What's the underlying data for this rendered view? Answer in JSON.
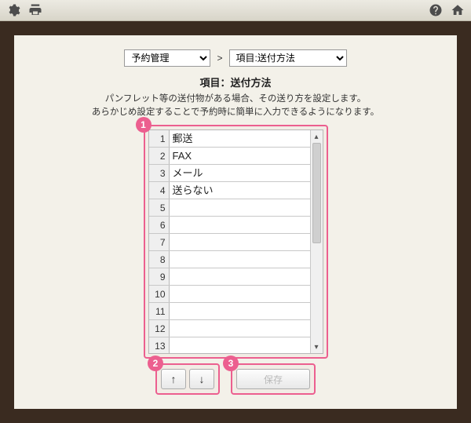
{
  "toolbar": {
    "icons": {
      "settings": "gear-icon",
      "print": "print-icon",
      "help": "help-icon",
      "home": "home-icon"
    }
  },
  "breadcrumb": {
    "left_selected": "予約管理",
    "separator": ">",
    "right_selected": "項目:送付方法"
  },
  "heading": "項目：送付方法",
  "description_line1": "パンフレット等の送付物がある場合、その送り方を設定します。",
  "description_line2": "あらかじめ設定することで予約時に簡単に入力できるようになります。",
  "annotations": {
    "grid": "1",
    "arrows": "2",
    "save": "3"
  },
  "grid": {
    "rows": [
      {
        "n": "1",
        "v": "郵送"
      },
      {
        "n": "2",
        "v": "FAX"
      },
      {
        "n": "3",
        "v": "メール"
      },
      {
        "n": "4",
        "v": "送らない"
      },
      {
        "n": "5",
        "v": ""
      },
      {
        "n": "6",
        "v": ""
      },
      {
        "n": "7",
        "v": ""
      },
      {
        "n": "8",
        "v": ""
      },
      {
        "n": "9",
        "v": ""
      },
      {
        "n": "10",
        "v": ""
      },
      {
        "n": "11",
        "v": ""
      },
      {
        "n": "12",
        "v": ""
      },
      {
        "n": "13",
        "v": ""
      }
    ]
  },
  "buttons": {
    "up": "↑",
    "down": "↓",
    "save": "保存"
  },
  "colors": {
    "annotation": "#ec5f8f",
    "paper": "#f3f1e9",
    "frame": "#3a2b20"
  }
}
